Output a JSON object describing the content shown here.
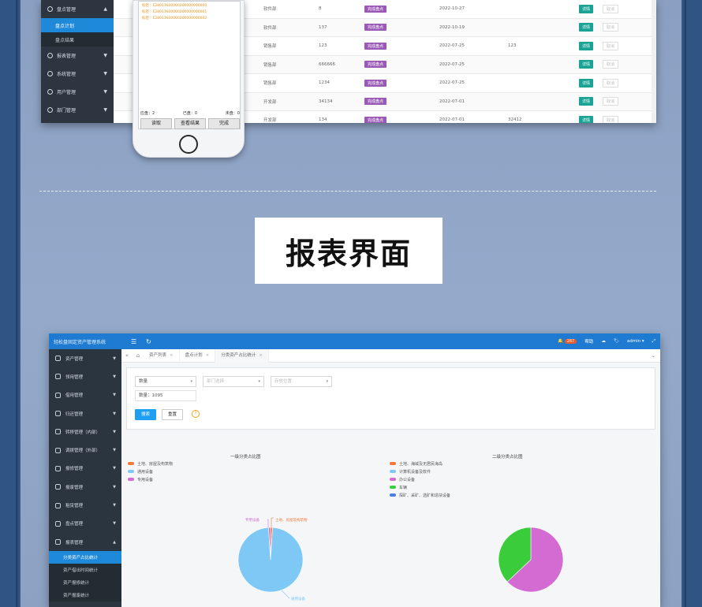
{
  "colors": {
    "top_bar": "#1e7bd1",
    "sidebar": "#2b3540",
    "active": "#1e88d9",
    "teal": "#1aa395",
    "purple": "#9b59b6"
  },
  "top_screenshot": {
    "sidebar": {
      "section": "盘点管理",
      "subs": [
        {
          "label": "盘点计划",
          "active": true
        },
        {
          "label": "盘点结果",
          "active": false
        }
      ],
      "items": [
        "报表管理",
        "系统管理",
        "用户管理",
        "部门管理"
      ]
    },
    "rows": [
      {
        "dept": "软件部",
        "num": "8",
        "status": "完成盘点",
        "date": "2022-10-27",
        "extra": "",
        "detail": "详情",
        "cancel": "取消"
      },
      {
        "dept": "软件部",
        "num": "137",
        "status": "完成盘点",
        "date": "2022-10-19",
        "extra": "",
        "detail": "详情",
        "cancel": "取消"
      },
      {
        "dept": "销售部",
        "num": "123",
        "status": "完成盘点",
        "date": "2022-07-25",
        "extra": "123",
        "detail": "详情",
        "cancel": "取消"
      },
      {
        "dept": "销售部",
        "num": "666666",
        "status": "完成盘点",
        "date": "2022-07-25",
        "extra": "",
        "detail": "详情",
        "cancel": "取消"
      },
      {
        "dept": "销售部",
        "num": "1234",
        "status": "完成盘点",
        "date": "2022-07-25",
        "extra": "",
        "detail": "详情",
        "cancel": "取消"
      },
      {
        "dept": "开发部",
        "num": "34134",
        "status": "完成盘点",
        "date": "2022-07-01",
        "extra": "",
        "detail": "详情",
        "cancel": "取消"
      },
      {
        "dept": "开发部",
        "num": "134",
        "status": "完成盘点",
        "date": "2022-07-01",
        "extra": "32412",
        "detail": "详情",
        "cancel": "取消"
      }
    ]
  },
  "phone": {
    "codes": [
      "标签：E28011600000200000000000",
      "标签：E28011600000200000000001",
      "标签：E28011600000200000000002"
    ],
    "stats": {
      "a_label": "应盘：",
      "a_val": "2",
      "b_label": "已盘：",
      "b_val": "0",
      "c_label": "未盘：",
      "c_val": "0"
    },
    "buttons": [
      "读取",
      "查看结果",
      "完成"
    ]
  },
  "section_title": "报表界面",
  "app": {
    "brand": "轻松盘固定资产管理系统",
    "header": {
      "notif_count": "267",
      "help": "帮助",
      "user": "admin"
    },
    "sidebar": {
      "items": [
        "资产管理",
        "领用管理",
        "借用管理",
        "归还管理",
        "转移管理（内部）",
        "调拨管理（外部）",
        "报修管理",
        "报废管理",
        "租赁管理",
        "盘点管理",
        "报表管理"
      ],
      "subs": [
        {
          "label": "分类资产占比统计",
          "active": true
        },
        {
          "label": "资产借出时间统计",
          "active": false
        },
        {
          "label": "资产报修统计",
          "active": false
        },
        {
          "label": "资产报废统计",
          "active": false
        }
      ]
    },
    "tabs": [
      "资产列表",
      "盘点计划",
      "分类资产占比统计"
    ],
    "filter": {
      "sel1": "数量",
      "sel2_placeholder": "部门选择",
      "sel3_placeholder": "存放位置",
      "count_label": "数量：1095",
      "search_btn": "搜索",
      "reset_btn": "重置"
    }
  },
  "chart_data": [
    {
      "type": "pie",
      "title": "一级分类占比图",
      "categories": [
        "土地、房屋及构筑物",
        "通用设备",
        "专用设备"
      ],
      "values": [
        1,
        98,
        1
      ],
      "colors": [
        "#f07b39",
        "#7ec8f5",
        "#d46bd3"
      ],
      "callouts": [
        "专用设备",
        "土地、房屋及构筑物",
        "通用设备"
      ]
    },
    {
      "type": "pie",
      "title": "二级分类占比图",
      "categories": [
        "土地、海域及无居民海岛",
        "计算机设备及软件",
        "办公设备",
        "车辆",
        "探矿、采矿、选矿和造块设备"
      ],
      "values": [
        0,
        0,
        63,
        37,
        0
      ],
      "colors": [
        "#f07b39",
        "#7ec8f5",
        "#d46bd3",
        "#3bcc3b",
        "#4a7fe0"
      ]
    }
  ]
}
